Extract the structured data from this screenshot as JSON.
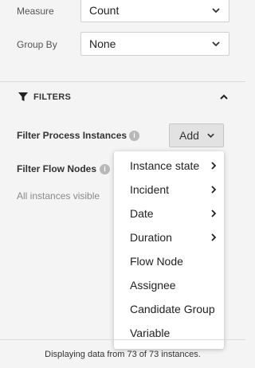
{
  "controls": {
    "measure": {
      "label": "Measure",
      "value": "Count"
    },
    "group_by": {
      "label": "Group By",
      "value": "None"
    }
  },
  "filters": {
    "title": "FILTERS",
    "process_instances_label": "Filter Process Instances",
    "flow_nodes_label": "Filter Flow Nodes",
    "add_label": "Add",
    "hint": "All instances visible",
    "info_glyph": "i"
  },
  "menu": {
    "items": [
      {
        "label": "Instance state",
        "submenu": true
      },
      {
        "label": "Incident",
        "submenu": true
      },
      {
        "label": "Date",
        "submenu": true
      },
      {
        "label": "Duration",
        "submenu": true
      },
      {
        "label": "Flow Node",
        "submenu": false
      },
      {
        "label": "Assignee",
        "submenu": false
      },
      {
        "label": "Candidate Group",
        "submenu": false
      },
      {
        "label": "Variable",
        "submenu": false
      }
    ]
  },
  "footer": {
    "text": "Displaying data from 73 of 73 instances."
  },
  "icons": {
    "funnel": "funnel-icon",
    "collapse": "chevron-up-icon",
    "dropdown": "chevron-down-icon",
    "submenu": "chevron-right-icon",
    "info": "info-icon"
  }
}
